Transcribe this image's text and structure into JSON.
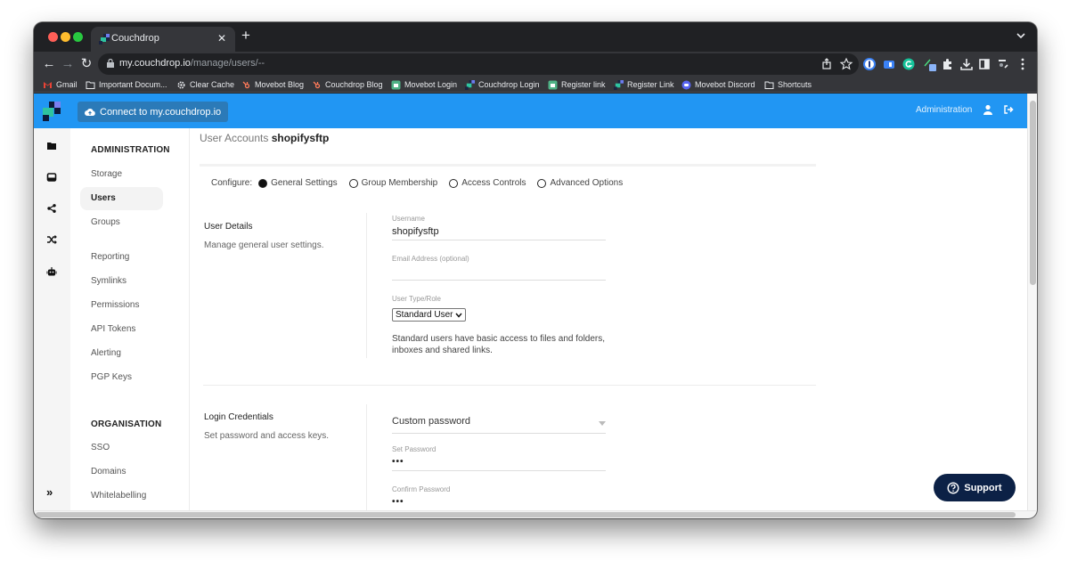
{
  "browser": {
    "tab_title": "Couchdrop",
    "url_host": "my.couchdrop.io",
    "url_path": "/manage/users/--",
    "bookmarks": [
      {
        "label": "Gmail",
        "icon": "gmail-icon"
      },
      {
        "label": "Important Docum...",
        "icon": "folder-icon"
      },
      {
        "label": "Clear Cache",
        "icon": "gear-icon"
      },
      {
        "label": "Movebot Blog",
        "icon": "hubspot-icon"
      },
      {
        "label": "Couchdrop Blog",
        "icon": "hubspot-icon"
      },
      {
        "label": "Movebot Login",
        "icon": "movebot-icon"
      },
      {
        "label": "Couchdrop Login",
        "icon": "couchdrop-icon"
      },
      {
        "label": "Register link",
        "icon": "movebot-icon"
      },
      {
        "label": "Register Link",
        "icon": "couchdrop-icon"
      },
      {
        "label": "Movebot Discord",
        "icon": "discord-icon"
      },
      {
        "label": "Shortcuts",
        "icon": "folder-icon"
      }
    ]
  },
  "header": {
    "connect_label": "Connect to my.couchdrop.io",
    "admin_label": "Administration",
    "brand_color": "#2196f3"
  },
  "sidebar": {
    "administration_heading": "ADMINISTRATION",
    "admin_items": [
      {
        "label": "Storage",
        "active": false
      },
      {
        "label": "Users",
        "active": true
      },
      {
        "label": "Groups",
        "active": false
      },
      {
        "label": "Reporting",
        "active": false
      },
      {
        "label": "Symlinks",
        "active": false
      },
      {
        "label": "Permissions",
        "active": false
      },
      {
        "label": "API Tokens",
        "active": false
      },
      {
        "label": "Alerting",
        "active": false
      },
      {
        "label": "PGP Keys",
        "active": false
      }
    ],
    "organisation_heading": "ORGANISATION",
    "org_items": [
      {
        "label": "SSO"
      },
      {
        "label": "Domains"
      },
      {
        "label": "Whitelabelling"
      }
    ]
  },
  "main": {
    "breadcrumb_prefix": "User Accounts",
    "breadcrumb_user": "shopifysftp",
    "configure_label": "Configure:",
    "configure_options": [
      {
        "label": "General Settings",
        "selected": true
      },
      {
        "label": "Group Membership",
        "selected": false
      },
      {
        "label": "Access Controls",
        "selected": false
      },
      {
        "label": "Advanced Options",
        "selected": false
      }
    ],
    "user_details": {
      "title": "User Details",
      "description": "Manage general user settings.",
      "username_label": "Username",
      "username_value": "shopifysftp",
      "email_label": "Email Address (optional)",
      "email_value": "",
      "role_label": "User Type/Role",
      "role_value": "Standard User",
      "role_description": "Standard users have basic access to files and folders, inboxes and shared links."
    },
    "login_credentials": {
      "title": "Login Credentials",
      "description": "Set password and access keys.",
      "password_mode": "Custom password",
      "set_password_label": "Set Password",
      "set_password_value": "•••",
      "confirm_password_label": "Confirm Password",
      "confirm_password_value": "•••"
    }
  },
  "support_label": "Support"
}
